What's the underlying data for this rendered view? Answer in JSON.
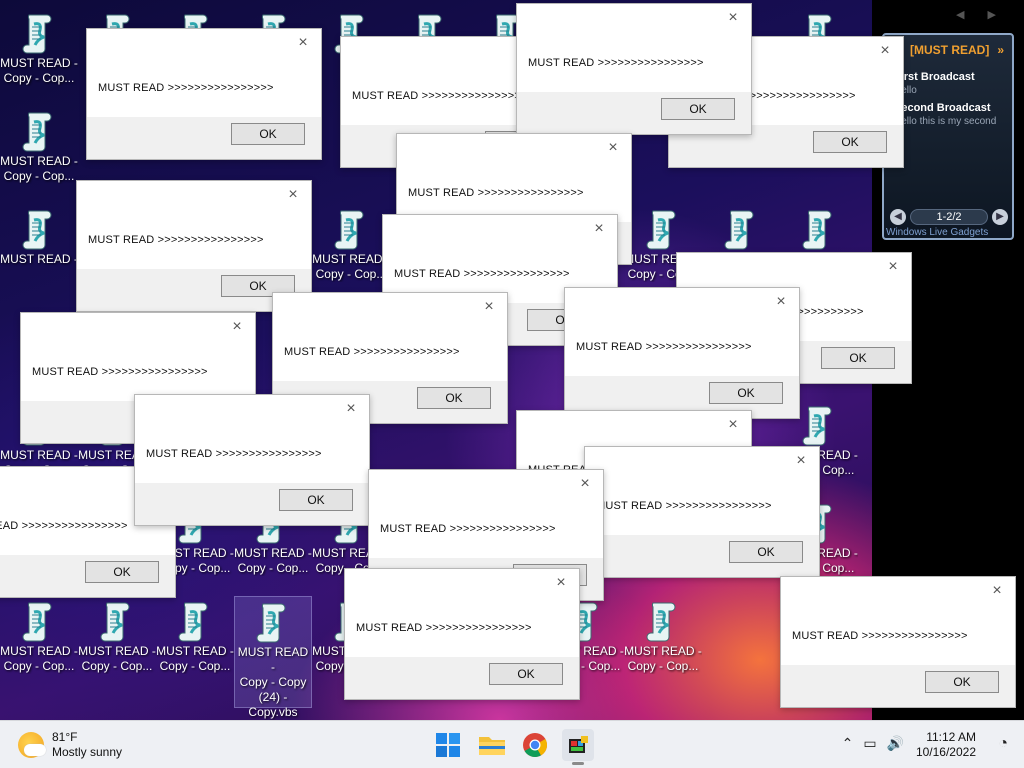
{
  "desktop": {
    "icons": [
      {
        "id": "i1",
        "label": "MUST READ -\nCopy - Cop..."
      },
      {
        "id": "i2",
        "label": ""
      },
      {
        "id": "i3",
        "label": ""
      },
      {
        "id": "i4",
        "label": ""
      },
      {
        "id": "i5",
        "label": ""
      },
      {
        "id": "i6",
        "label": ""
      },
      {
        "id": "i7",
        "label": ""
      },
      {
        "id": "i8",
        "label": ""
      },
      {
        "id": "i9",
        "label": "MUST READ -\nCopy - Cop..."
      },
      {
        "id": "i10",
        "label": "MUST READ -"
      },
      {
        "id": "i11",
        "label": "MUST READ -"
      },
      {
        "id": "i12",
        "label": "MUST READ -"
      },
      {
        "id": "i13",
        "label": "MUST READ -\nCopy - Cop..."
      },
      {
        "id": "i14",
        "label": "MUST READ -\nCopy - Cop..."
      },
      {
        "id": "i15",
        "label": "MUST READ -\nCopy - Cop..."
      },
      {
        "id": "i16",
        "label": "MUST READ -\nCopy - Cop..."
      },
      {
        "id": "i17",
        "label": "MUST READ -\nCopy - Cop..."
      },
      {
        "id": "i18",
        "label": "MUST READ -\nCopy - Cop..."
      },
      {
        "id": "i19",
        "label": "MUST READ -\nCopy - Cop..."
      },
      {
        "id": "i20",
        "label": "MUST READ -\nCopy - Cop..."
      },
      {
        "id": "i21",
        "label": "MUST READ -\nCopy - Cop..."
      },
      {
        "id": "i22",
        "label": "MUST READ -\nCopy - Cop..."
      },
      {
        "id": "i23",
        "label": "MUST READ -\nCopy - Cop..."
      },
      {
        "id": "i24",
        "label": "MUST READ -\nCopy - Copy\n(24) -\nCopy.vbs"
      },
      {
        "id": "i25",
        "label": "MUST READ -\nCopy - Cop..."
      },
      {
        "id": "i26",
        "label": "MUST READ -\nCopy - Cop..."
      },
      {
        "id": "i27",
        "label": "MUST READ -\nCopy - Cop..."
      },
      {
        "id": "i28",
        "label": "MUST READ -\nCopy - Cop..."
      },
      {
        "id": "i29",
        "label": "MUST READ -\nCopy - Cop..."
      },
      {
        "id": "i30",
        "label": "MUST READ -\nCopy - Cop..."
      }
    ]
  },
  "gadget": {
    "title": "[MUST READ]",
    "arrow": "»",
    "items": [
      {
        "title": "First Broadcast",
        "body": "Hello"
      },
      {
        "title": "Second Broadcast",
        "body": "Hello this is my second"
      }
    ],
    "page": "1-2/2",
    "footer": "Windows Live Gadgets"
  },
  "dialogs": [
    {
      "message": "MUST READ >>>>>>>>>>>>>>>>",
      "ok": "OK"
    },
    {
      "message": "MUST READ >>>>>>>>>>>>>>>>",
      "ok": "OK"
    },
    {
      "message": "MUST READ >>>>>>>>>>>>>>>>",
      "ok": "OK"
    },
    {
      "message": "MUST READ >>>>>>>>>>>>>>>>",
      "ok": "OK"
    },
    {
      "message": "MUST READ >>>>>>>>>>>>>>>>",
      "ok": "OK"
    },
    {
      "message": "MUST READ >>>>>>>>>>>>>>>>",
      "ok": "OK"
    },
    {
      "message": "MUST READ >>>>>>>>>>>>>>>>",
      "ok": "OK"
    },
    {
      "message": "MUST READ >>>>>>>>>>>>>>>>",
      "ok": "OK"
    },
    {
      "message": "MUST READ >>>>>>>>>>>>>>>>",
      "ok": "OK"
    },
    {
      "message": "MUST READ >>>>>>>>>>>>>>>>",
      "ok": "OK"
    },
    {
      "message": "MUST READ >>>>>>>>>>>>>>>>",
      "ok": "OK"
    },
    {
      "message": "MUST READ >>>>>>>>>>>>>>>>",
      "ok": "OK"
    },
    {
      "message": "MUST READ >>>>>>>>>>>>>>>>",
      "ok": "OK"
    },
    {
      "message": "MUST READ >>>>>>>>>>>>>>>>",
      "ok": "OK"
    },
    {
      "message": "MUST READ >>>>>>>>>>>>>>>>",
      "ok": "OK"
    },
    {
      "message": "MUST READ >>>>>>>>>>>>>>>>",
      "ok": "OK"
    },
    {
      "message": "MUST READ >>>>>>>>>>>>>>>>",
      "ok": "OK"
    },
    {
      "message": "MUST READ >>>>>>>>>>>>>>>>",
      "ok": "OK"
    }
  ],
  "taskbar": {
    "weather_temp": "81°F",
    "weather_desc": "Mostly sunny",
    "time": "11:12 AM",
    "date": "10/16/2022",
    "pinned": [
      "start-button",
      "file-explorer",
      "chrome",
      "active-app"
    ]
  },
  "colors": {
    "gadget_title": "#f0a030",
    "taskbar_bg": "#eef0f4",
    "dialog_bg": "#f0f0f0"
  }
}
